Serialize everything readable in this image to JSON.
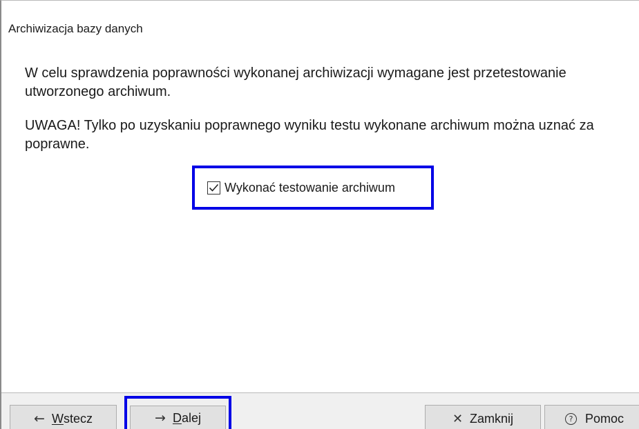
{
  "window": {
    "title": "Archiwizacja bazy danych"
  },
  "content": {
    "paragraph1": "W celu sprawdzenia poprawności wykonanej archiwizacji wymagane jest przetestowanie utworzonego archiwum.",
    "paragraph2": "UWAGA! Tylko po uzyskaniu poprawnego wyniku testu wykonane archiwum można uznać za poprawne.",
    "test_checkbox": {
      "label": "Wykonać testowanie archiwum",
      "checked": true
    }
  },
  "footer": {
    "back": {
      "hotkey_letter": "W",
      "rest": "stecz",
      "icon": "arrow-left-icon",
      "glyph": "←"
    },
    "next": {
      "hotkey_letter": "D",
      "rest": "alej",
      "icon": "arrow-right-icon",
      "glyph": "→"
    },
    "close": {
      "label": "Zamknij",
      "icon": "close-icon",
      "glyph": "✕"
    },
    "help": {
      "label": "Pomoc",
      "icon": "help-icon",
      "glyph": "?"
    }
  },
  "colors": {
    "highlight": "#0000e6",
    "footer_bg": "#f0f0f0",
    "button_bg": "#e1e1e1"
  }
}
